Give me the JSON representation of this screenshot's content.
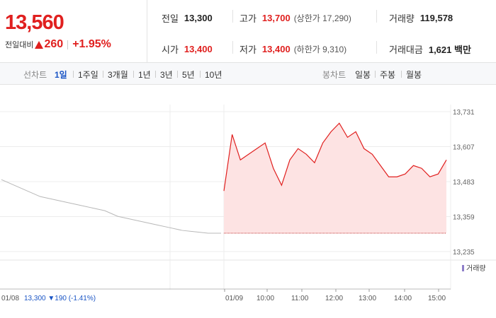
{
  "quote": {
    "price": "13,560",
    "change_label": "전일대비",
    "change": "260",
    "change_rate": "+1.95%"
  },
  "stats": {
    "prev_close": {
      "label": "전일",
      "value": "13,300"
    },
    "high": {
      "label": "고가",
      "value": "13,700",
      "sub": "(상한가 17,290)"
    },
    "volume": {
      "label": "거래량",
      "value": "119,578"
    },
    "open": {
      "label": "시가",
      "value": "13,400"
    },
    "low": {
      "label": "저가",
      "value": "13,400",
      "sub": "(하한가 9,310)"
    },
    "amount": {
      "label": "거래대금",
      "value": "1,621 백만"
    }
  },
  "toolbar": {
    "line_label": "선차트",
    "line_periods": [
      "1일",
      "1주일",
      "3개월",
      "1년",
      "3년",
      "5년",
      "10년"
    ],
    "active_period": "1일",
    "candle_label": "봉차트",
    "candle_periods": [
      "일봉",
      "주봉",
      "월봉"
    ]
  },
  "colors": {
    "up": "#e0201f",
    "down": "#1a55c5",
    "active": "#1a55c5",
    "volume": "#8e7ec9"
  },
  "chart_data": {
    "type": "line",
    "y_ticks": [
      "13,731",
      "13,607",
      "13,483",
      "13,359",
      "13,235"
    ],
    "y_tick_values": [
      13731,
      13607,
      13483,
      13359,
      13235
    ],
    "x_ticks": [
      "01/09",
      "10:00",
      "11:00",
      "12:00",
      "13:00",
      "14:00",
      "15:00"
    ],
    "prev_day_label": "01/08",
    "prev_day_summary": {
      "close": "13,300",
      "change": "190",
      "rate": "(-1.41%)"
    },
    "volume_legend": "거래량",
    "ylim": [
      13235,
      13731
    ],
    "prev_close": 13300,
    "previous_day_series": [
      13490,
      13470,
      13450,
      13430,
      13420,
      13410,
      13400,
      13390,
      13380,
      13360,
      13350,
      13340,
      13330,
      13320,
      13310,
      13305,
      13300,
      13300
    ],
    "today_series": [
      13450,
      13650,
      13560,
      13580,
      13600,
      13620,
      13530,
      13470,
      13560,
      13600,
      13580,
      13550,
      13620,
      13660,
      13690,
      13640,
      13660,
      13600,
      13580,
      13540,
      13500,
      13500,
      13510,
      13540,
      13530,
      13500,
      13510,
      13560
    ]
  }
}
